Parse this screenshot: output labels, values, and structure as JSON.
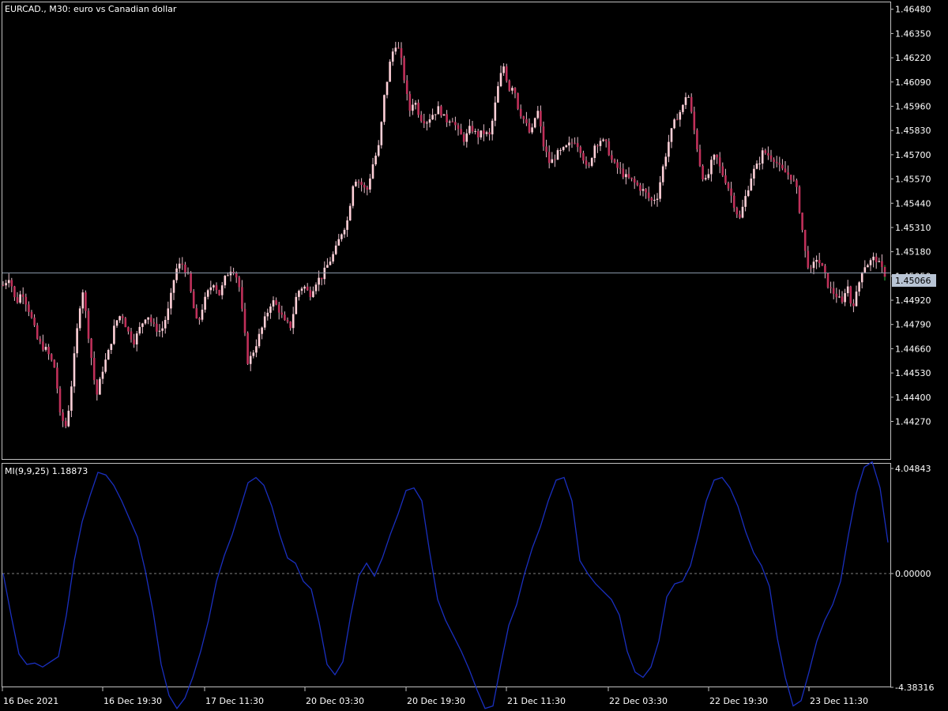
{
  "colors": {
    "background": "#000000",
    "frame": "#c0c0c0",
    "text": "#ffffff",
    "candle_bull_body": "#ffd0d8",
    "candle_bear_body": "#c0305a",
    "wick": "#e8c0cc",
    "last_wick": "#30c040",
    "current_price_line": "#8896a8",
    "current_price_label_bg": "#b8c4d4",
    "current_price_label_text": "#000000",
    "oscillator_line": "#1a2fbf",
    "zero_line": "#808080"
  },
  "main_pane": {
    "title": "EURCAD., M30:  euro vs Canadian dollar",
    "price_axis_labels": [
      "1.46480",
      "1.46350",
      "1.46220",
      "1.46090",
      "1.45960",
      "1.45830",
      "1.45700",
      "1.45570",
      "1.45440",
      "1.45310",
      "1.45180",
      "1.45050",
      "1.44920",
      "1.44790",
      "1.44660",
      "1.44530",
      "1.44400",
      "1.44270"
    ],
    "current_price": "1.45066"
  },
  "indicator_pane": {
    "title": "MI(9,9,25) 1.18873",
    "axis_labels": [
      "4.04843",
      "0.00000",
      "-4.38316"
    ]
  },
  "time_axis_labels": [
    "16 Dec 2021",
    "16 Dec 19:30",
    "17 Dec 11:30",
    "20 Dec 03:30",
    "20 Dec 19:30",
    "21 Dec 11:30",
    "22 Dec 03:30",
    "22 Dec 19:30",
    "23 Dec 11:30"
  ],
  "chart_data": [
    {
      "type": "candlestick",
      "symbol": "EURCAD.",
      "timeframe": "M30",
      "title": "EURCAD., M30:  euro vs Canadian dollar",
      "ylim": [
        1.442,
        1.465
      ],
      "current_price": 1.45066,
      "close_path": [
        [
          0,
          1.45
        ],
        [
          8,
          1.4505
        ],
        [
          16,
          1.449
        ],
        [
          24,
          1.4497
        ],
        [
          34,
          1.4485
        ],
        [
          44,
          1.447
        ],
        [
          55,
          1.4465
        ],
        [
          66,
          1.4455
        ],
        [
          72,
          1.443
        ],
        [
          80,
          1.4424
        ],
        [
          86,
          1.4445
        ],
        [
          92,
          1.447
        ],
        [
          100,
          1.45
        ],
        [
          106,
          1.448
        ],
        [
          112,
          1.446
        ],
        [
          118,
          1.444
        ],
        [
          126,
          1.4455
        ],
        [
          134,
          1.4465
        ],
        [
          142,
          1.448
        ],
        [
          150,
          1.4485
        ],
        [
          158,
          1.4475
        ],
        [
          166,
          1.447
        ],
        [
          174,
          1.4478
        ],
        [
          182,
          1.4485
        ],
        [
          190,
          1.4478
        ],
        [
          200,
          1.4475
        ],
        [
          210,
          1.4488
        ],
        [
          218,
          1.4508
        ],
        [
          226,
          1.4512
        ],
        [
          234,
          1.4505
        ],
        [
          240,
          1.449
        ],
        [
          246,
          1.4478
        ],
        [
          252,
          1.4488
        ],
        [
          258,
          1.4495
        ],
        [
          266,
          1.4502
        ],
        [
          274,
          1.4495
        ],
        [
          282,
          1.4505
        ],
        [
          290,
          1.451
        ],
        [
          298,
          1.4502
        ],
        [
          304,
          1.448
        ],
        [
          310,
          1.4458
        ],
        [
          318,
          1.4466
        ],
        [
          326,
          1.4475
        ],
        [
          334,
          1.4485
        ],
        [
          340,
          1.4492
        ],
        [
          348,
          1.4488
        ],
        [
          356,
          1.448
        ],
        [
          364,
          1.4478
        ],
        [
          372,
          1.4496
        ],
        [
          380,
          1.45
        ],
        [
          388,
          1.4495
        ],
        [
          396,
          1.4502
        ],
        [
          404,
          1.4505
        ],
        [
          412,
          1.4512
        ],
        [
          420,
          1.4518
        ],
        [
          428,
          1.4528
        ],
        [
          436,
          1.4535
        ],
        [
          444,
          1.4558
        ],
        [
          452,
          1.4555
        ],
        [
          460,
          1.455
        ],
        [
          468,
          1.4565
        ],
        [
          476,
          1.4575
        ],
        [
          482,
          1.46
        ],
        [
          490,
          1.462
        ],
        [
          496,
          1.463
        ],
        [
          502,
          1.4625
        ],
        [
          508,
          1.461
        ],
        [
          514,
          1.4593
        ],
        [
          520,
          1.46
        ],
        [
          528,
          1.459
        ],
        [
          536,
          1.4588
        ],
        [
          544,
          1.4592
        ],
        [
          552,
          1.4595
        ],
        [
          560,
          1.4588
        ],
        [
          568,
          1.459
        ],
        [
          576,
          1.4582
        ],
        [
          584,
          1.4578
        ],
        [
          592,
          1.4585
        ],
        [
          600,
          1.458
        ],
        [
          608,
          1.4582
        ],
        [
          616,
          1.458
        ],
        [
          622,
          1.4595
        ],
        [
          628,
          1.461
        ],
        [
          634,
          1.4618
        ],
        [
          640,
          1.4605
        ],
        [
          646,
          1.4608
        ],
        [
          652,
          1.4595
        ],
        [
          660,
          1.4588
        ],
        [
          668,
          1.458
        ],
        [
          676,
          1.4595
        ],
        [
          684,
          1.4575
        ],
        [
          692,
          1.4565
        ],
        [
          700,
          1.457
        ],
        [
          708,
          1.4572
        ],
        [
          716,
          1.4575
        ],
        [
          724,
          1.4578
        ],
        [
          732,
          1.4572
        ],
        [
          740,
          1.456
        ],
        [
          748,
          1.4575
        ],
        [
          756,
          1.4578
        ],
        [
          764,
          1.4575
        ],
        [
          772,
          1.4565
        ],
        [
          780,
          1.4562
        ],
        [
          788,
          1.4558
        ],
        [
          796,
          1.4556
        ],
        [
          804,
          1.4553
        ],
        [
          812,
          1.455
        ],
        [
          820,
          1.4545
        ],
        [
          828,
          1.4548
        ],
        [
          836,
          1.4565
        ],
        [
          844,
          1.458
        ],
        [
          852,
          1.459
        ],
        [
          860,
          1.4595
        ],
        [
          866,
          1.4605
        ],
        [
          872,
          1.459
        ],
        [
          878,
          1.4575
        ],
        [
          884,
          1.456
        ],
        [
          890,
          1.4555
        ],
        [
          896,
          1.4565
        ],
        [
          902,
          1.457
        ],
        [
          908,
          1.4562
        ],
        [
          916,
          1.4555
        ],
        [
          924,
          1.4545
        ],
        [
          932,
          1.4535
        ],
        [
          940,
          1.4548
        ],
        [
          948,
          1.456
        ],
        [
          956,
          1.4565
        ],
        [
          962,
          1.4572
        ],
        [
          968,
          1.457
        ],
        [
          976,
          1.4568
        ],
        [
          984,
          1.4562
        ],
        [
          992,
          1.456
        ],
        [
          998,
          1.4558
        ],
        [
          1004,
          1.4552
        ],
        [
          1010,
          1.4535
        ],
        [
          1016,
          1.4515
        ],
        [
          1022,
          1.4507
        ],
        [
          1030,
          1.4515
        ],
        [
          1038,
          1.4508
        ],
        [
          1046,
          1.4498
        ],
        [
          1054,
          1.4495
        ],
        [
          1062,
          1.449
        ],
        [
          1068,
          1.4502
        ],
        [
          1074,
          1.4488
        ],
        [
          1080,
          1.4495
        ],
        [
          1088,
          1.451
        ],
        [
          1096,
          1.4512
        ],
        [
          1104,
          1.4515
        ],
        [
          1110,
          1.451
        ],
        [
          1116,
          1.4506
        ],
        [
          1122,
          1.45066
        ]
      ]
    },
    {
      "type": "line",
      "title": "MI(9,9,25) 1.18873",
      "last_value": 1.18873,
      "ylim": [
        -4.38316,
        4.04843
      ],
      "reference_line": 0.0,
      "points": [
        [
          0,
          0.0
        ],
        [
          10,
          -1.6
        ],
        [
          20,
          -3.1
        ],
        [
          30,
          -3.5
        ],
        [
          40,
          -3.45
        ],
        [
          50,
          -3.6
        ],
        [
          60,
          -3.4
        ],
        [
          70,
          -3.2
        ],
        [
          80,
          -1.6
        ],
        [
          90,
          0.5
        ],
        [
          100,
          2.0
        ],
        [
          110,
          3.0
        ],
        [
          120,
          3.9
        ],
        [
          130,
          3.8
        ],
        [
          140,
          3.4
        ],
        [
          150,
          2.8
        ],
        [
          160,
          2.1
        ],
        [
          170,
          1.4
        ],
        [
          180,
          0.1
        ],
        [
          190,
          -1.5
        ],
        [
          200,
          -3.5
        ],
        [
          210,
          -4.7
        ],
        [
          220,
          -5.2
        ],
        [
          230,
          -4.8
        ],
        [
          240,
          -4.0
        ],
        [
          250,
          -3.0
        ],
        [
          260,
          -1.8
        ],
        [
          270,
          -0.3
        ],
        [
          280,
          0.7
        ],
        [
          290,
          1.5
        ],
        [
          300,
          2.5
        ],
        [
          310,
          3.5
        ],
        [
          320,
          3.7
        ],
        [
          330,
          3.4
        ],
        [
          340,
          2.6
        ],
        [
          350,
          1.5
        ],
        [
          360,
          0.6
        ],
        [
          370,
          0.4
        ],
        [
          380,
          -0.3
        ],
        [
          390,
          -0.6
        ],
        [
          400,
          -1.9
        ],
        [
          410,
          -3.5
        ],
        [
          420,
          -3.9
        ],
        [
          430,
          -3.4
        ],
        [
          440,
          -1.6
        ],
        [
          450,
          -0.1
        ],
        [
          460,
          0.4
        ],
        [
          470,
          -0.1
        ],
        [
          480,
          0.6
        ],
        [
          490,
          1.5
        ],
        [
          500,
          2.3
        ],
        [
          510,
          3.2
        ],
        [
          520,
          3.3
        ],
        [
          530,
          2.8
        ],
        [
          540,
          0.8
        ],
        [
          550,
          -1.0
        ],
        [
          560,
          -1.8
        ],
        [
          570,
          -2.4
        ],
        [
          580,
          -3.0
        ],
        [
          590,
          -3.7
        ],
        [
          600,
          -4.5
        ],
        [
          610,
          -5.2
        ],
        [
          620,
          -5.1
        ],
        [
          630,
          -3.5
        ],
        [
          640,
          -2.0
        ],
        [
          650,
          -1.2
        ],
        [
          660,
          0.0
        ],
        [
          670,
          1.0
        ],
        [
          680,
          1.8
        ],
        [
          690,
          2.8
        ],
        [
          700,
          3.6
        ],
        [
          710,
          3.7
        ],
        [
          720,
          2.8
        ],
        [
          730,
          0.5
        ],
        [
          740,
          0.0
        ],
        [
          750,
          -0.4
        ],
        [
          760,
          -0.7
        ],
        [
          770,
          -1.0
        ],
        [
          780,
          -1.6
        ],
        [
          790,
          -3.0
        ],
        [
          800,
          -3.8
        ],
        [
          810,
          -4.0
        ],
        [
          820,
          -3.6
        ],
        [
          830,
          -2.6
        ],
        [
          840,
          -0.9
        ],
        [
          850,
          -0.4
        ],
        [
          860,
          -0.3
        ],
        [
          870,
          0.3
        ],
        [
          880,
          1.5
        ],
        [
          890,
          2.8
        ],
        [
          900,
          3.6
        ],
        [
          910,
          3.7
        ],
        [
          920,
          3.3
        ],
        [
          930,
          2.6
        ],
        [
          940,
          1.6
        ],
        [
          950,
          0.8
        ],
        [
          960,
          0.3
        ],
        [
          970,
          -0.5
        ],
        [
          980,
          -2.5
        ],
        [
          990,
          -4.0
        ],
        [
          1000,
          -5.1
        ],
        [
          1010,
          -4.9
        ],
        [
          1020,
          -3.8
        ],
        [
          1030,
          -2.6
        ],
        [
          1040,
          -1.8
        ],
        [
          1050,
          -1.2
        ],
        [
          1060,
          -0.3
        ],
        [
          1070,
          1.5
        ],
        [
          1080,
          3.1
        ],
        [
          1090,
          4.1
        ],
        [
          1100,
          4.3
        ],
        [
          1110,
          3.3
        ],
        [
          1120,
          1.2
        ]
      ]
    }
  ]
}
